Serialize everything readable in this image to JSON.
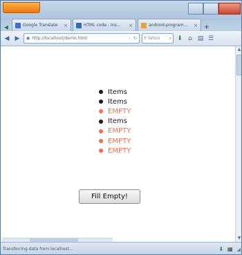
{
  "browser": {
    "tabs": [
      {
        "label": "Google Translate",
        "color": "#3b6fd0"
      },
      {
        "label": "HTML code - Ins...",
        "color": "#2f6fb8"
      },
      {
        "label": "android-program...",
        "color": "#e3a43a"
      }
    ],
    "url": "http://localhost/demo.html",
    "search_placeholder": "Yahoo"
  },
  "list": {
    "items": [
      {
        "text": "Items",
        "state": "filled"
      },
      {
        "text": "Items",
        "state": "filled"
      },
      {
        "text": "EMPTY",
        "state": "empty"
      },
      {
        "text": "Items",
        "state": "filled"
      },
      {
        "text": "EMPTY",
        "state": "empty"
      },
      {
        "text": "EMPTY",
        "state": "empty"
      },
      {
        "text": "EMPTY",
        "state": "empty"
      }
    ],
    "colors": {
      "filled": "#1a1a1a",
      "empty": "#ff6a4a"
    }
  },
  "fill_button": {
    "label": "Fill Empty!"
  },
  "status": {
    "text": "Transferring data from localhost..."
  }
}
